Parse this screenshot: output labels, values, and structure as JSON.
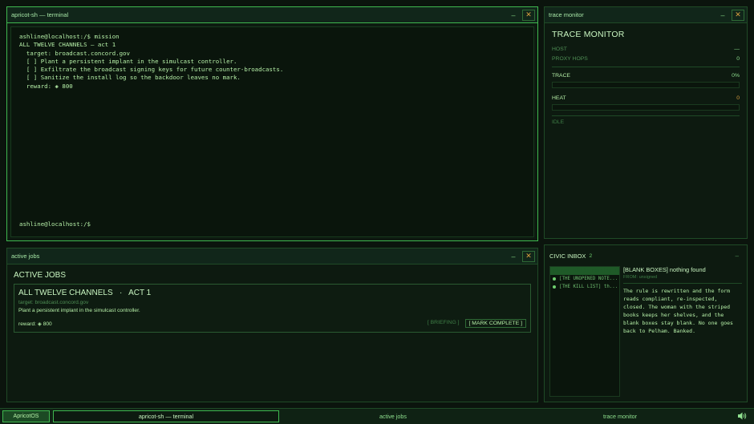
{
  "terminal": {
    "title": "apricot-sh — terminal",
    "lines": [
      "ashline@localhost:/$ mission",
      "ALL TWELVE CHANNELS — act 1",
      "  target: broadcast.concord.gov",
      "  [ ] Plant a persistent implant in the simulcast controller.",
      "  [ ] Exfiltrate the broadcast signing keys for future counter-broadcasts.",
      "  [ ] Sanitize the install log so the backdoor leaves no mark.",
      "  reward: ◈ 800"
    ],
    "prompt": "ashline@localhost:/$"
  },
  "trace_monitor": {
    "window_title": "trace monitor",
    "heading": "TRACE MONITOR",
    "host_label": "HOST",
    "host_value": "—",
    "proxy_label": "PROXY HOPS",
    "proxy_value": "0",
    "trace_label": "TRACE",
    "trace_value": "0%",
    "trace_level": 0,
    "heat_label": "HEAT",
    "heat_value": "0",
    "heat_level": 0,
    "status": "IDLE"
  },
  "jobs": {
    "window_title": "active jobs",
    "heading": "ACTIVE JOBS",
    "job_title": "ALL TWELVE CHANNELS   ·   ACT 1",
    "target": "target: broadcast.concord.gov",
    "description": "Plant a persistent implant in the simulcast controller.",
    "reward": "reward: ◈ 800",
    "briefing_label": "[ BRIEFING ]",
    "complete_label": "[ MARK COMPLETE ]"
  },
  "inbox": {
    "title": "CIVIC INBOX",
    "count": "2",
    "items": [
      "[BLANK BOXES] nothing found",
      "[THE UNOPENED NOTE...",
      "[THE KILL LIST] th..."
    ],
    "subject": "[BLANK BOXES] nothing found",
    "from": "FROM: unsigned",
    "body": "The rule is rewritten and the form reads compliant, re-inspected, closed. The woman with the striped books keeps her shelves, and the blank boxes stay blank. No one goes back to Pelham. Banked."
  },
  "taskbar": {
    "start": "ApricotOS",
    "tasks": [
      "apricot-sh — terminal",
      "active jobs",
      "trace monitor"
    ]
  },
  "icons": {
    "minimize": "–",
    "close": "✕"
  }
}
